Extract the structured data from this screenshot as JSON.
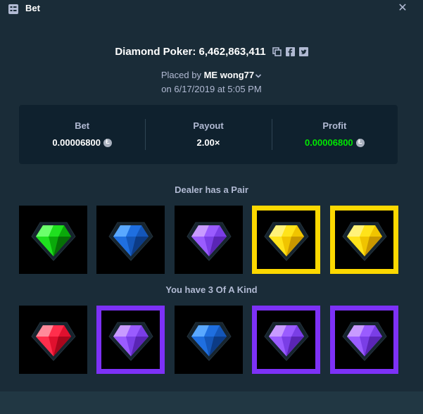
{
  "header": {
    "title": "Bet"
  },
  "game": {
    "name_and_id": "Diamond Poker: 6,462,863,411"
  },
  "placed": {
    "prefix": "Placed by",
    "user": "ME wong77",
    "date": "on 6/17/2019 at 5:05 PM"
  },
  "stats": {
    "bet": {
      "label": "Bet",
      "value": "0.00006800"
    },
    "payout": {
      "label": "Payout",
      "value": "2.00×"
    },
    "profit": {
      "label": "Profit",
      "value": "0.00006800"
    }
  },
  "dealer": {
    "label": "Dealer has a Pair",
    "cards": [
      {
        "gem": "green",
        "highlight": "none"
      },
      {
        "gem": "blue",
        "highlight": "none"
      },
      {
        "gem": "purple",
        "highlight": "none"
      },
      {
        "gem": "yellow",
        "highlight": "yellow"
      },
      {
        "gem": "yellow",
        "highlight": "yellow"
      }
    ]
  },
  "player": {
    "label": "You have 3 Of A Kind",
    "cards": [
      {
        "gem": "red",
        "highlight": "none"
      },
      {
        "gem": "purple",
        "highlight": "purple"
      },
      {
        "gem": "blue",
        "highlight": "none"
      },
      {
        "gem": "purple",
        "highlight": "purple"
      },
      {
        "gem": "purple",
        "highlight": "purple"
      }
    ]
  },
  "colors": {
    "background": "#1a2c38",
    "panel": "#0f212e",
    "profit_green": "#00e701",
    "highlight_yellow": "#fcd800",
    "highlight_purple": "#7d31f7"
  },
  "icons": {
    "header": "bet-list-icon",
    "close": "close-icon",
    "copy": "copy-icon",
    "facebook": "facebook-icon",
    "twitter": "twitter-icon",
    "currency": "litecoin-icon"
  }
}
